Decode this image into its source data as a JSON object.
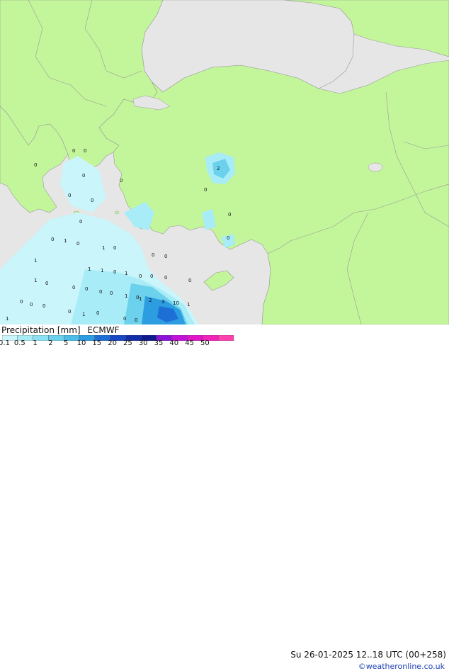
{
  "legend": {
    "title": "Precipitation [mm]",
    "model": "ECMWF",
    "scale_labels": [
      "0.1",
      "0.5",
      "1",
      "2",
      "5",
      "10",
      "15",
      "20",
      "25",
      "30",
      "35",
      "40",
      "45",
      "50"
    ],
    "scale_colors": [
      "#c9f5fb",
      "#a8ecf7",
      "#8be0f2",
      "#6cd1ec",
      "#4bbde6",
      "#2b9de0",
      "#1d6fd6",
      "#1848c4",
      "#122da8",
      "#0f1a8c",
      "#8c14d8",
      "#c212d8",
      "#e014c8",
      "#f024b8",
      "#ff40b0"
    ]
  },
  "valid_time": "Su 26-01-2025 12..18 UTC (00+258)",
  "copyright": "©weatheronline.co.uk",
  "map": {
    "land_color": "#c3f69a",
    "sea_color": "#e6e6e6",
    "border_color": "#9a9a9a",
    "precip_values": [
      "0",
      "0",
      "0",
      "0",
      "2",
      "0",
      "0",
      "0",
      "0",
      "0",
      "0",
      "0",
      "1",
      "0",
      "0",
      "1",
      "0",
      "0",
      "0",
      "1",
      "1",
      "1",
      "0",
      "1",
      "0",
      "0",
      "0",
      "0",
      "1",
      "0",
      "0",
      "0",
      "0",
      "0",
      "1",
      "0",
      "1",
      "2",
      "3",
      "10",
      "1",
      "0",
      "0",
      "0",
      "0",
      "1",
      "0",
      "1",
      "0",
      "0"
    ]
  }
}
